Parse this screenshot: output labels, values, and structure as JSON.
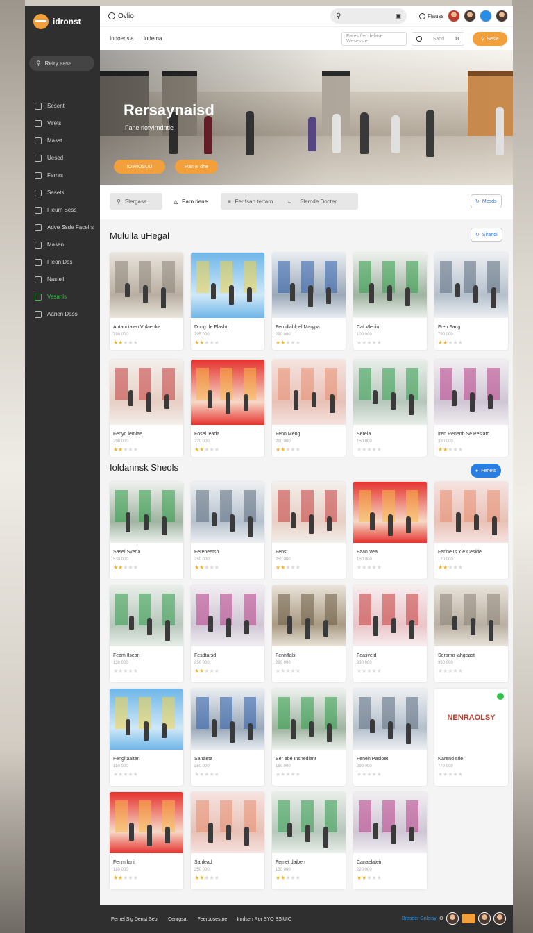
{
  "app": {
    "brand": "idronst",
    "title": "Ovlio"
  },
  "sidebar": {
    "search_label": "Refry ease",
    "items": [
      {
        "label": "Sesent",
        "icon": "clock-icon"
      },
      {
        "label": "Virets",
        "icon": "heart-icon"
      },
      {
        "label": "Masst",
        "icon": "tag-icon"
      },
      {
        "label": "Uesed",
        "icon": "box-icon"
      },
      {
        "label": "Ferras",
        "icon": "mail-icon"
      },
      {
        "label": "Sasets",
        "icon": "gear-icon"
      },
      {
        "label": "Fleum Sess",
        "icon": "store-icon"
      },
      {
        "label": "Adve Ssde Facelrs",
        "icon": "globe-icon"
      },
      {
        "label": "Masen",
        "icon": "cart-icon"
      },
      {
        "label": "Fleon Dos",
        "icon": "chart-icon"
      },
      {
        "label": "Nastell",
        "icon": "people-icon"
      },
      {
        "label": "Vesanls",
        "icon": "leaf-icon",
        "accent": true
      },
      {
        "label": "Aarien Dass",
        "icon": "info-icon"
      }
    ]
  },
  "topbar": {
    "search_icon": "search-icon",
    "user_label": "Fiauss"
  },
  "subbar": {
    "tabs": [
      "Indoensia",
      "Indema"
    ],
    "field1_placeholder": "Fares fler defase Wesesste",
    "field2_placeholder": "Sand",
    "action_label": "Sesle"
  },
  "hero": {
    "title": "Rersaynaisd",
    "subtitle": "Fane rlotyIrndntle",
    "btn1": "IOIRIOSUU",
    "btn2": "Ran el dhe"
  },
  "filters": {
    "chip1": "Slergase",
    "chip2": "Parn riene",
    "chip3": "Fer fsan tertarn",
    "chip4": "Slemde Docter",
    "right_btn": "Mesds"
  },
  "section1": {
    "title": "Mululla uHegal",
    "btn": "Sirandi",
    "cards": [
      {
        "name": "Autani taien Vnlaenka",
        "price": "790 000",
        "rating": 2
      },
      {
        "name": "Dong de Flashn",
        "price": "795 000",
        "rating": 2
      },
      {
        "name": "Ferndlabloel Marypa",
        "price": "290 000",
        "rating": 2
      },
      {
        "name": "Caf Vlenin",
        "price": "100 000",
        "rating": 0
      },
      {
        "name": "Fren Fang",
        "price": "790 000",
        "rating": 2
      },
      {
        "name": "Fenyd lemiae",
        "price": "290 000",
        "rating": 2
      },
      {
        "name": "Fosel leada",
        "price": "220 000",
        "rating": 2
      },
      {
        "name": "Fenn Meng",
        "price": "290 000",
        "rating": 2
      },
      {
        "name": "Serela",
        "price": "150 000",
        "rating": 0
      },
      {
        "name": "Iren Renenb Se Pesjatd",
        "price": "330 000",
        "rating": 2
      }
    ]
  },
  "section2": {
    "title": "Ioldannsk Sheols",
    "btn": "Fenets",
    "cards": [
      {
        "name": "Sasel Sveda",
        "price": "530 000",
        "rating": 2
      },
      {
        "name": "Fereneetsh",
        "price": "250 000",
        "rating": 2
      },
      {
        "name": "Fenst",
        "price": "250 000",
        "rating": 2
      },
      {
        "name": "Faan Vea",
        "price": "150 000",
        "rating": 0
      },
      {
        "name": "Farine Is Yle Ceside",
        "price": "170 000",
        "rating": 2
      },
      {
        "name": "Feam Ilsean",
        "price": "130 000",
        "rating": 0
      },
      {
        "name": "Fesdtarsd",
        "price": "250 000",
        "rating": 2
      },
      {
        "name": "Fennflals",
        "price": "290 000",
        "rating": 0
      },
      {
        "name": "Feasveld",
        "price": "330 000",
        "rating": 0
      },
      {
        "name": "Seramo lahgeast",
        "price": "330 000",
        "rating": 0
      },
      {
        "name": "Fengitaalten",
        "price": "150 000",
        "rating": 0
      },
      {
        "name": "Sanaeta",
        "price": "350 000",
        "rating": 0
      },
      {
        "name": "Ser ebe Insnediant",
        "price": "150 000",
        "rating": 0
      },
      {
        "name": "Feneh Pasloet",
        "price": "290 000",
        "rating": 0
      },
      {
        "name": "Narend srie",
        "price": "770 000",
        "rating": 0
      },
      {
        "name": "Fenm lanil",
        "price": "180 000",
        "rating": 2
      },
      {
        "name": "Sanlead",
        "price": "250 000",
        "rating": 2
      },
      {
        "name": "Femet daiben",
        "price": "130 000",
        "rating": 2
      },
      {
        "name": "Canaelatein",
        "price": "220 000",
        "rating": 2
      }
    ],
    "promo_text": "NENRAOLSY"
  },
  "footer": {
    "links": [
      "Fernel Sig Denst Sebi",
      "Cenrgsat",
      "Feerbosestne",
      "Inrdsen Ror SYO BSIUIO"
    ],
    "right_label": "Bresder Gnleisy"
  }
}
